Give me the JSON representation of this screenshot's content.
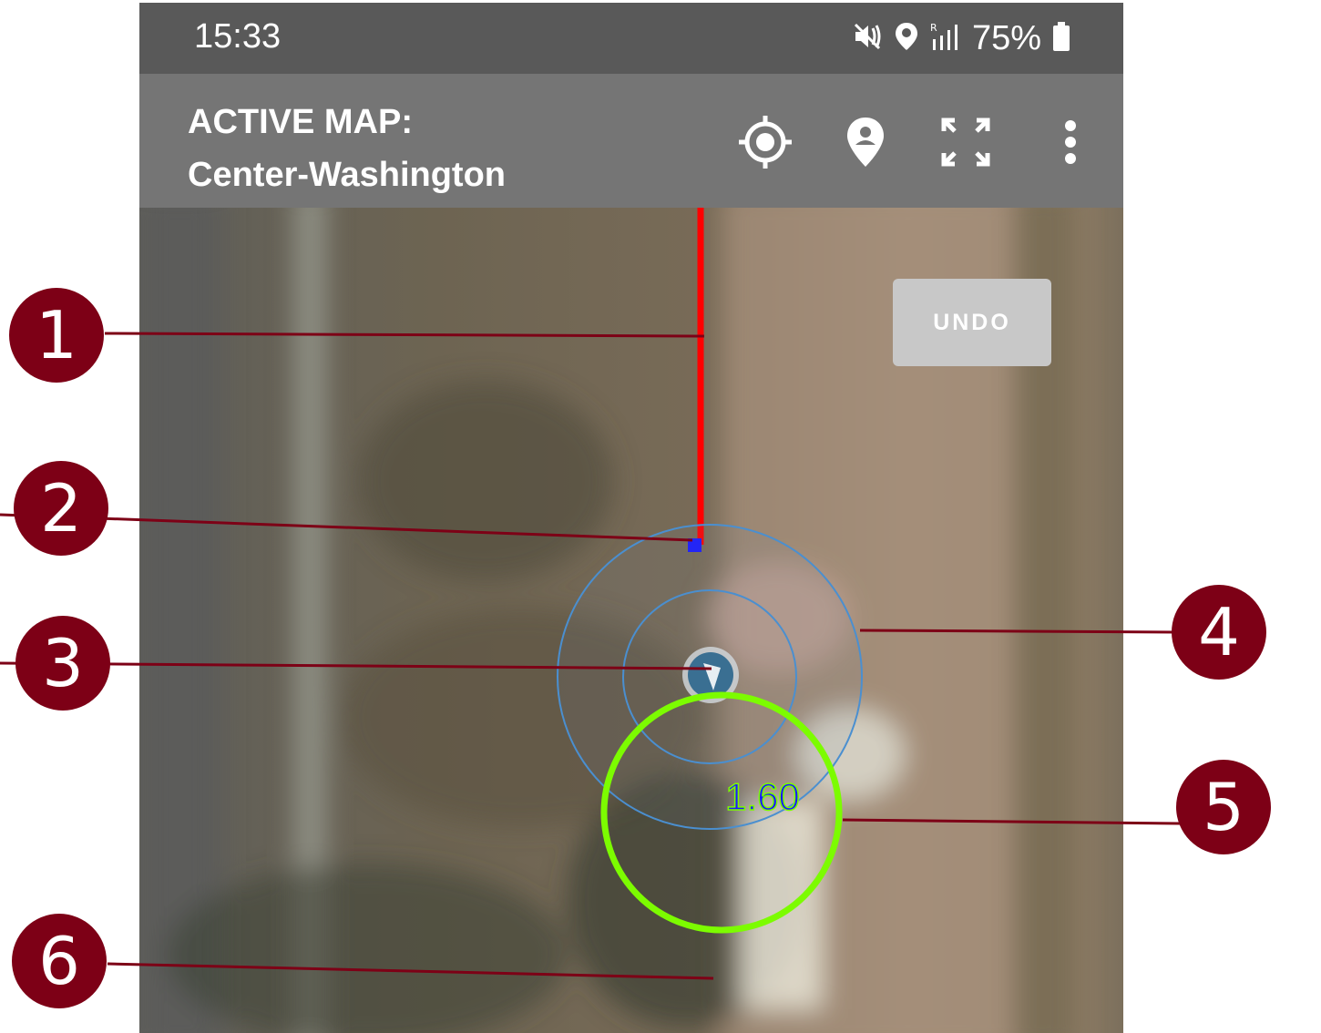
{
  "status_bar": {
    "time": "15:33",
    "battery": "75%",
    "icons": [
      "mute-vibrate-icon",
      "location-icon",
      "signal-icon",
      "battery-icon"
    ]
  },
  "app_bar": {
    "title_line1": "ACTIVE MAP:",
    "title_line2": "Center-Washington",
    "actions": [
      "gps-target-icon",
      "location-pin-icon",
      "fullscreen-icon",
      "more-vert-icon"
    ]
  },
  "map": {
    "undo_label": "UNDO",
    "accuracy_label": "1.60",
    "colors": {
      "track_line": "#ff0000",
      "vertex": "#1a1aff",
      "accuracy_circle": "#4a8fd0",
      "target_ring": "#7cfc00",
      "label_text": "#1a1aff"
    }
  },
  "callouts": [
    "1",
    "2",
    "3",
    "4",
    "5",
    "6"
  ],
  "callout_color": "#7d0016"
}
